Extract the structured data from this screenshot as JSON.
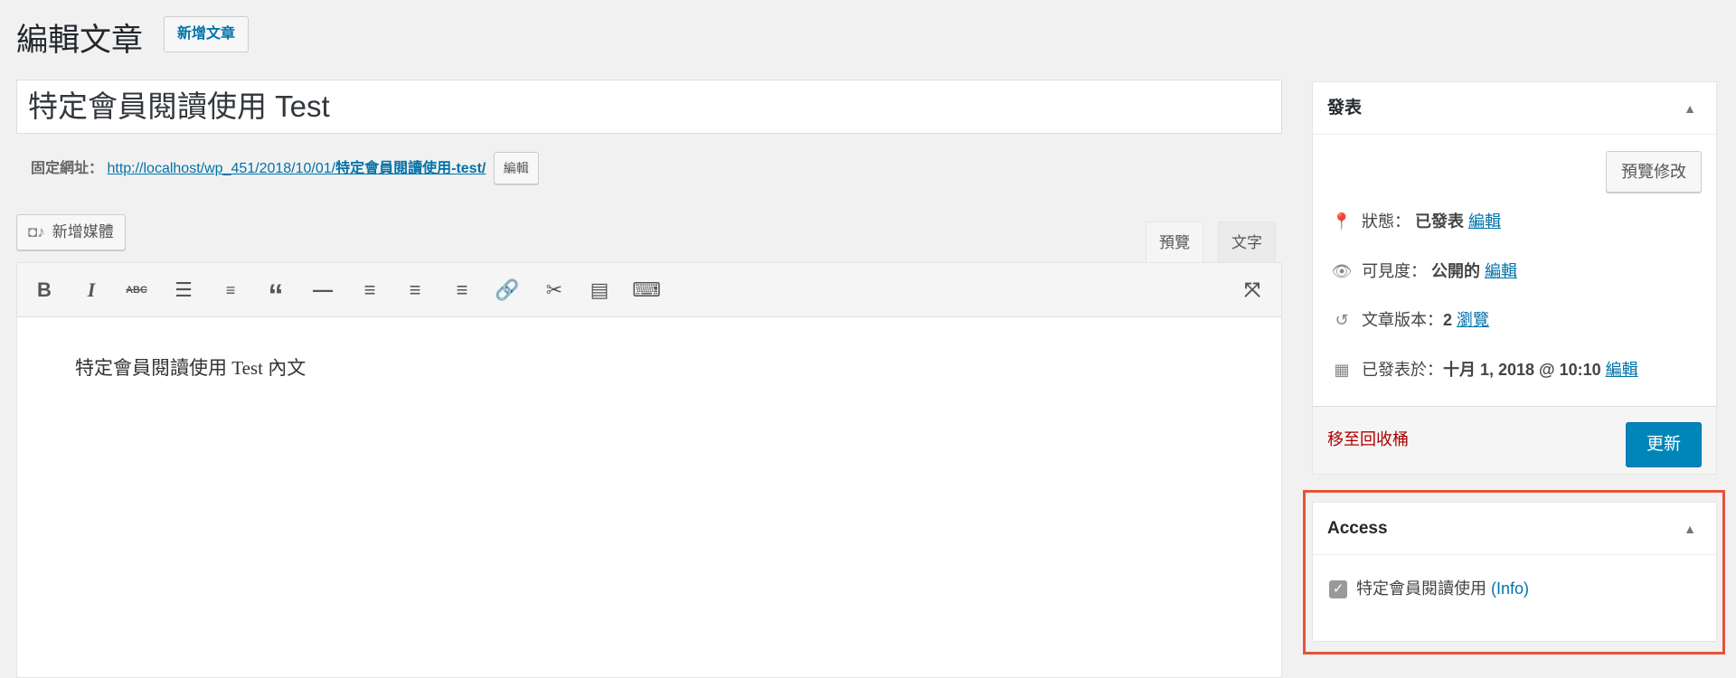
{
  "header": {
    "title": "編輯文章",
    "add_new": "新增文章"
  },
  "post": {
    "title": "特定會員閱讀使用 Test",
    "permalink_label": "固定網址：",
    "permalink_url": "http://localhost/wp_451/2018/10/01/",
    "permalink_slug": "特定會員閱讀使用-test/",
    "permalink_edit": "編輯"
  },
  "editor": {
    "add_media": "新增媒體",
    "tabs": [
      "預覽",
      "文字"
    ],
    "content": "特定會員閱讀使用 Test 內文",
    "toolbar": [
      "bold-icon",
      "italic-icon",
      "strikethrough-icon",
      "bullet-list-icon",
      "numbered-list-icon",
      "blockquote-icon",
      "horizontal-rule-icon",
      "align-left-icon",
      "align-center-icon",
      "align-right-icon",
      "link-icon",
      "unlink-icon",
      "read-more-icon",
      "toolbar-toggle-icon",
      "fullscreen-icon"
    ]
  },
  "publish": {
    "title": "發表",
    "preview": "預覽修改",
    "status_label": "狀態：",
    "status_value": "已發表",
    "status_edit": "編輯",
    "visibility_label": "可見度：",
    "visibility_value": "公開的",
    "visibility_edit": "編輯",
    "revisions_label": "文章版本：",
    "revisions_value": "2",
    "revisions_browse": "瀏覽",
    "published_label": "已發表於：",
    "published_value": "十月 1, 2018 @ 10:10",
    "published_edit": "編輯",
    "trash": "移至回收桶",
    "update": "更新"
  },
  "access": {
    "title": "Access",
    "option": "特定會員閱讀使用",
    "info": "(Info)",
    "checked": true
  },
  "colors": {
    "link": "#0073aa",
    "primary": "#0085ba",
    "trash": "#a00",
    "highlight": "#e8533a"
  }
}
